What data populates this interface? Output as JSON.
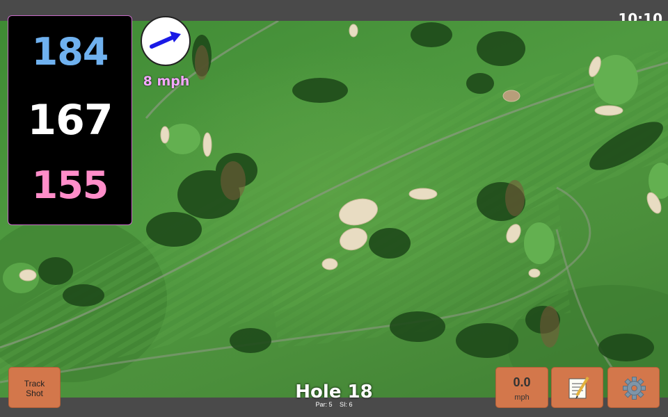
{
  "status": {
    "time": "10:10"
  },
  "distances": {
    "back": "184",
    "middle": "167",
    "front": "155"
  },
  "wind": {
    "speed_label": "8 mph",
    "direction_icon": "arrow-icon"
  },
  "buttons": {
    "track_line1": "Track",
    "track_line2": "Shot",
    "speed_value": "0.0",
    "speed_unit": "mph",
    "notes_icon": "memo-icon",
    "settings_icon": "gear-icon"
  },
  "hole": {
    "title": "Hole 18",
    "par": "Par: 5",
    "si": "SI: 6"
  },
  "colors": {
    "back": "#6fb1ef",
    "middle": "#ffffff",
    "front": "#ff8dc9",
    "button": "#d3774b",
    "wind_text": "#f4a8ff"
  }
}
